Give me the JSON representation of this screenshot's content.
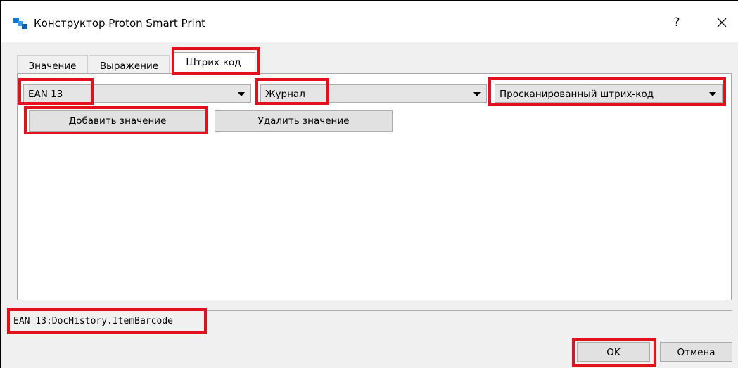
{
  "window": {
    "title": "Конструктор Proton Smart Print",
    "help_label": "?",
    "accent_color": "#0a78d4"
  },
  "tabs": [
    {
      "label": "Значение",
      "active": false
    },
    {
      "label": "Выражение",
      "active": false
    },
    {
      "label": "Штрих-код",
      "active": true
    }
  ],
  "barcode": {
    "type_combo": {
      "value": "EAN 13"
    },
    "source_combo": {
      "value": "Журнал"
    },
    "field_combo": {
      "value": "Просканированный штрих-код"
    },
    "add_label": "Добавить значение",
    "remove_label": "Удалить значение"
  },
  "result": {
    "value": "EAN 13:DocHistory.ItemBarcode"
  },
  "footer": {
    "ok_label": "OK",
    "cancel_label": "Отмена"
  },
  "highlight_color": "#e3101d",
  "icons": [
    "app-icon",
    "help-icon",
    "close-icon",
    "dropdown-arrow-icon"
  ]
}
